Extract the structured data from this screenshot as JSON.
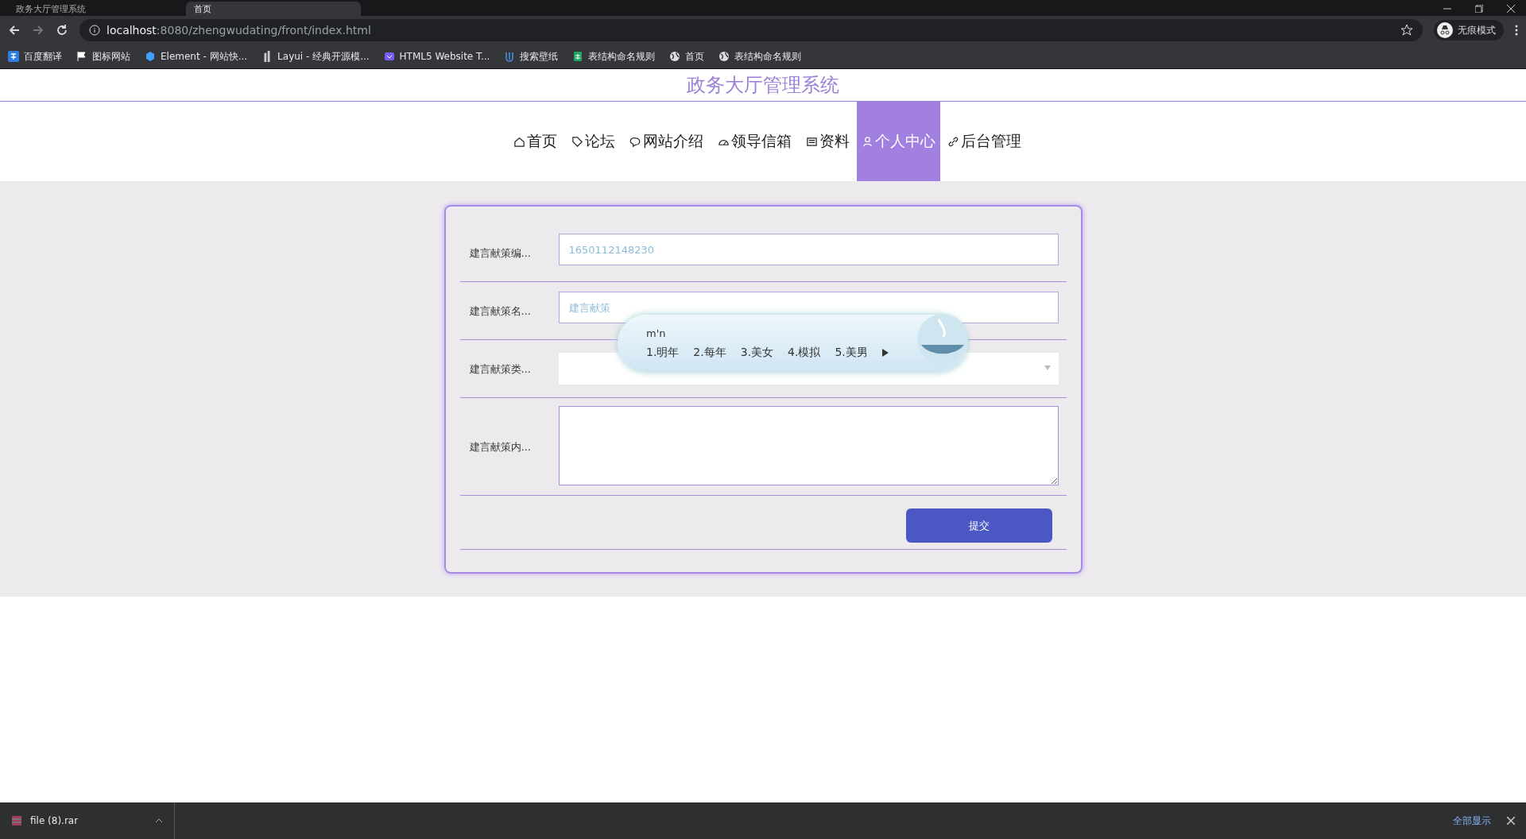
{
  "browser": {
    "tabs": [
      {
        "title": "政务大厅管理系统",
        "selected": false
      },
      {
        "title": "首页",
        "selected": true
      }
    ],
    "url_host": "localhost",
    "url_rest": ":8080/zhengwudating/front/index.html",
    "profile": "无痕模式",
    "bookmarks": [
      {
        "label": "百度翻译"
      },
      {
        "label": "图标网站"
      },
      {
        "label": "Element - 网站快..."
      },
      {
        "label": "Layui - 经典开源模..."
      },
      {
        "label": "HTML5 Website T..."
      },
      {
        "label": "搜索壁纸"
      },
      {
        "label": "表结构命名规则"
      },
      {
        "label": "首页"
      },
      {
        "label": "表结构命名规则"
      }
    ]
  },
  "site_title": "政务大厅管理系统",
  "nav": [
    {
      "label": "首页",
      "selected": false
    },
    {
      "label": "论坛",
      "selected": false
    },
    {
      "label": "网站介绍",
      "selected": false
    },
    {
      "label": "领导信箱",
      "selected": false
    },
    {
      "label": "资料",
      "selected": false
    },
    {
      "label": "个人中心",
      "selected": true
    },
    {
      "label": "后台管理",
      "selected": false
    }
  ],
  "form": {
    "fields": [
      {
        "kind": "input",
        "label": "建言献策编...",
        "value": "1650112148230"
      },
      {
        "kind": "input",
        "label": "建言献策名...",
        "placeholder": "建言献策"
      },
      {
        "kind": "select",
        "label": "建言献策类..."
      },
      {
        "kind": "textarea",
        "label": "建言献策内..."
      }
    ],
    "submit": "提交"
  },
  "ime": {
    "composition": "m'n",
    "candidates": [
      "1.明年",
      "2.每年",
      "3.美女",
      "4.模拟",
      "5.美男"
    ]
  },
  "downloads": {
    "file": "file (8).rar",
    "show_all": "全部显示"
  }
}
